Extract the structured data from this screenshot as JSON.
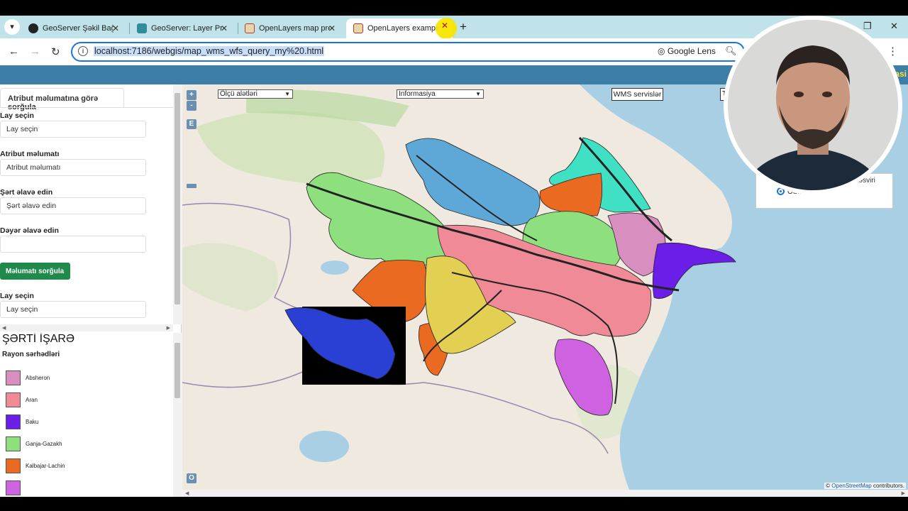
{
  "tabs": [
    {
      "title": "GeoServer Şəkil Bağl",
      "active": false
    },
    {
      "title": "GeoServer: Layer Pre",
      "active": false
    },
    {
      "title": "OpenLayers map pre",
      "active": false
    },
    {
      "title": "OpenLayers example",
      "active": true
    }
  ],
  "toolbar": {
    "url": "localhost:7186/webgis/map_wms_wfs_query_my%20.html",
    "lens_label": "Google Lens"
  },
  "header": {
    "title_fragment": "asi"
  },
  "query_panel": {
    "tab_label": "Atribut məlumatına görə sorğula",
    "fields": [
      {
        "label": "Lay seçin",
        "value": "Lay seçin"
      },
      {
        "label": "Atribut məlumatı",
        "value": "Atribut məlumatı"
      },
      {
        "label": "Şərt əlavə edin",
        "value": "Şərt əlavə edin"
      },
      {
        "label": "Dəyər əlavə edin",
        "value": ""
      }
    ],
    "query_button": "Məlumatı sorğula",
    "second_layer": {
      "label": "Lay seçin",
      "value": "Lay seçin"
    }
  },
  "legend": {
    "title": "ŞƏRTİ İŞARƏ",
    "subtitle": "Rayon sərhədləri",
    "items": [
      {
        "name": "Absheron",
        "color": "#d98ec0"
      },
      {
        "name": "Aran",
        "color": "#f08a96"
      },
      {
        "name": "Baku",
        "color": "#6a1ee8"
      },
      {
        "name": "Ganja-Gazakh",
        "color": "#8ee07f"
      },
      {
        "name": "Kalbajar-Lachin",
        "color": "#ea6a22"
      },
      {
        "name": "",
        "color": "#cf62e0"
      }
    ]
  },
  "map": {
    "zoom_in": "+",
    "zoom_out": "-",
    "e_button": "E",
    "o_button": "O",
    "measure_select": "Ölçü alətləri",
    "info_select": "İnformasiya",
    "wms_button": "WMS servislər",
    "t_button": "T",
    "popup_title_fragment": "k təsviri",
    "popup_option_fragment": "OSM",
    "attribution_prefix": "© ",
    "attribution_link": "OpenStreetMap",
    "attribution_suffix": " contributors."
  },
  "colors": {
    "header_bar": "#3c7ea6",
    "button_green": "#1f8a4c",
    "sea": "#a9cfe4",
    "region_blue": "#5ea8d8",
    "region_teal": "#3fe0c4"
  }
}
